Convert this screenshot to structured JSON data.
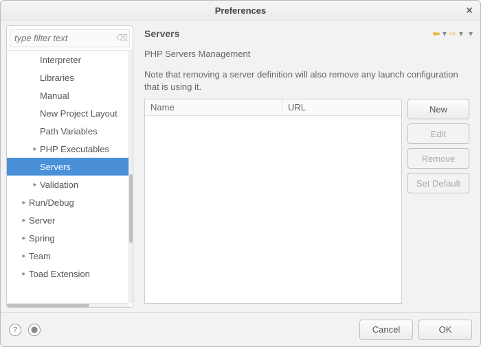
{
  "window": {
    "title": "Preferences"
  },
  "filter": {
    "placeholder": "type filter text"
  },
  "tree": {
    "items": [
      {
        "label": "Interpreter",
        "level": 2,
        "arrow": "",
        "selected": false
      },
      {
        "label": "Libraries",
        "level": 2,
        "arrow": "",
        "selected": false
      },
      {
        "label": "Manual",
        "level": 2,
        "arrow": "",
        "selected": false
      },
      {
        "label": "New Project Layout",
        "level": 2,
        "arrow": "",
        "selected": false
      },
      {
        "label": "Path Variables",
        "level": 2,
        "arrow": "",
        "selected": false
      },
      {
        "label": "PHP Executables",
        "level": 2,
        "arrow": "▸",
        "selected": false
      },
      {
        "label": "Servers",
        "level": 2,
        "arrow": "",
        "selected": true
      },
      {
        "label": "Validation",
        "level": 2,
        "arrow": "▸",
        "selected": false
      },
      {
        "label": "Run/Debug",
        "level": 1,
        "arrow": "▸",
        "selected": false
      },
      {
        "label": "Server",
        "level": 1,
        "arrow": "▸",
        "selected": false
      },
      {
        "label": "Spring",
        "level": 1,
        "arrow": "▸",
        "selected": false
      },
      {
        "label": "Team",
        "level": 1,
        "arrow": "▸",
        "selected": false
      },
      {
        "label": "Toad Extension",
        "level": 1,
        "arrow": "▸",
        "selected": false
      }
    ]
  },
  "main": {
    "heading": "Servers",
    "subtitle": "PHP Servers Management",
    "note": "Note that removing a server definition will also remove any launch configuration that is using it.",
    "columns": {
      "name": "Name",
      "url": "URL"
    },
    "buttons": {
      "new": "New",
      "edit": "Edit",
      "remove": "Remove",
      "setDefault": "Set Default"
    }
  },
  "nav": {
    "back": "⇦",
    "forward": "⇨",
    "dropdown": "▾",
    "menu": "▾"
  },
  "footer": {
    "cancel": "Cancel",
    "ok": "OK"
  }
}
